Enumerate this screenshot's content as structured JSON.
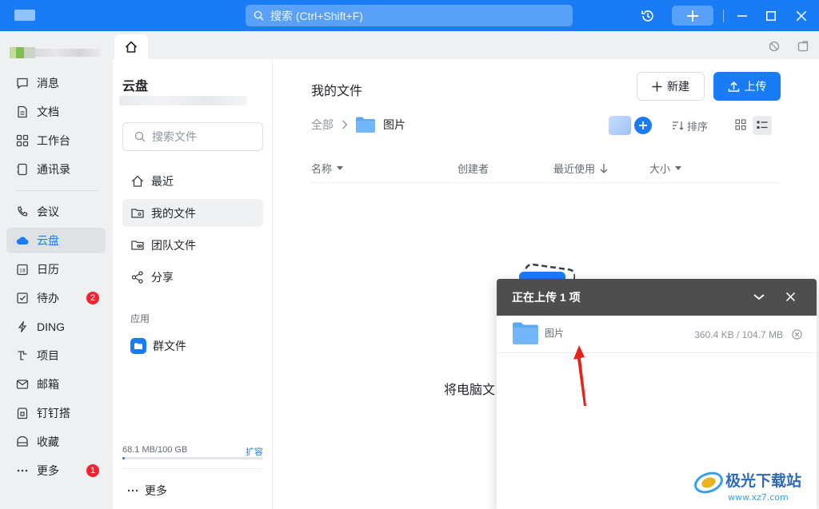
{
  "titlebar": {
    "search_placeholder": "搜索 (Ctrl+Shift+F)",
    "icons": [
      "history-icon",
      "plus-icon",
      "minimize-icon",
      "maximize-icon",
      "close-icon"
    ]
  },
  "nav": {
    "items": [
      {
        "label": "消息",
        "icon": "message-icon"
      },
      {
        "label": "文档",
        "icon": "document-icon"
      },
      {
        "label": "工作台",
        "icon": "workbench-icon"
      },
      {
        "label": "通讯录",
        "icon": "contacts-icon"
      },
      {
        "label": "会议",
        "icon": "phone-icon"
      },
      {
        "label": "云盘",
        "icon": "cloud-icon",
        "active": true
      },
      {
        "label": "日历",
        "icon": "calendar-icon"
      },
      {
        "label": "待办",
        "icon": "todo-icon",
        "badge": "2"
      },
      {
        "label": "DING",
        "icon": "lightning-icon"
      },
      {
        "label": "项目",
        "icon": "project-icon"
      },
      {
        "label": "邮箱",
        "icon": "mail-icon"
      },
      {
        "label": "钉钉搭",
        "icon": "builder-icon"
      },
      {
        "label": "收藏",
        "icon": "favorite-icon"
      },
      {
        "label": "更多",
        "icon": "more-icon",
        "badge": "1"
      }
    ]
  },
  "cloud": {
    "title": "云盘",
    "search_placeholder": "搜索文件",
    "items": [
      {
        "label": "最近",
        "icon": "home-icon"
      },
      {
        "label": "我的文件",
        "icon": "my-files-icon",
        "active": true
      },
      {
        "label": "团队文件",
        "icon": "team-files-icon"
      },
      {
        "label": "分享",
        "icon": "share-icon"
      }
    ],
    "apps_label": "应用",
    "apps": [
      {
        "label": "群文件",
        "icon": "group-files-icon"
      }
    ],
    "storage_text": "68.1 MB/100 GB",
    "storage_fraction": 0.0007,
    "expand_label": "扩容",
    "more_label": "更多"
  },
  "files": {
    "title": "我的文件",
    "new_label": "新建",
    "upload_label": "上传",
    "breadcrumb_root": "全部",
    "breadcrumb_current": "图片",
    "sort_label": "排序",
    "columns": {
      "name": "名称",
      "creator": "创建者",
      "recent": "最近使用",
      "size": "大小"
    },
    "empty_text": "将电脑文"
  },
  "upload_popup": {
    "title": "正在上传 1 项",
    "item_name": "图片",
    "item_size": "360.4 KB / 104.7 MB"
  },
  "watermark": {
    "text": "极光下载站",
    "url": "www.xz7.com"
  },
  "colors": {
    "accent": "#1a7cf5",
    "titlebar": "#1a7cf5",
    "popup_header": "#4e4e4e",
    "badge": "#f5222d",
    "arrow": "#e8221b"
  }
}
